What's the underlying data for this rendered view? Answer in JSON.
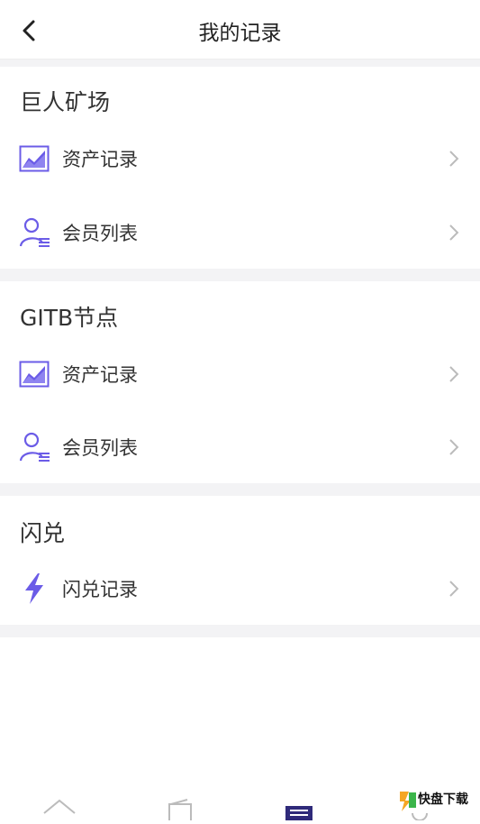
{
  "header": {
    "title": "我的记录"
  },
  "sections": [
    {
      "title": "巨人矿场",
      "items": [
        {
          "label": "资产记录",
          "icon": "chart-icon"
        },
        {
          "label": "会员列表",
          "icon": "member-icon"
        }
      ]
    },
    {
      "title": "GITB节点",
      "items": [
        {
          "label": "资产记录",
          "icon": "chart-icon"
        },
        {
          "label": "会员列表",
          "icon": "member-icon"
        }
      ]
    },
    {
      "title": "闪兑",
      "items": [
        {
          "label": "闪兑记录",
          "icon": "lightning-icon"
        }
      ]
    }
  ],
  "tabbar": {
    "icons": [
      "home-icon",
      "wallet-icon",
      "records-icon",
      "profile-icon"
    ]
  },
  "watermark": {
    "text": "快盘下载"
  },
  "colors": {
    "accent": "#6b5ce7",
    "accent_dark": "#2f2a7a",
    "gap": "#f3f3f5"
  }
}
